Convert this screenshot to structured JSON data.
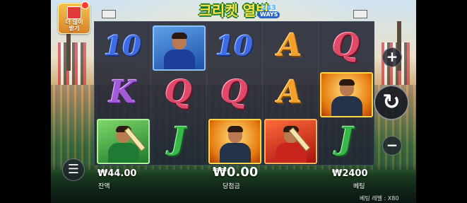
{
  "game": {
    "logo_title": "크리켓 열병",
    "logo_badge_number": "243",
    "logo_badge_text": "WAYS"
  },
  "promo_button": {
    "label_line1": "더 많이",
    "label_line2": "받기",
    "icon": "gift-icon"
  },
  "reels": [
    [
      {
        "type": "letter",
        "value": "10",
        "style": "g-10"
      },
      {
        "type": "letter",
        "value": "K",
        "style": "g-K"
      },
      {
        "type": "card",
        "icon": "batsman-green-icon",
        "color": "green"
      }
    ],
    [
      {
        "type": "card",
        "icon": "bowler-blue-icon",
        "color": "blue"
      },
      {
        "type": "letter",
        "value": "Q",
        "style": "g-Q"
      },
      {
        "type": "letter",
        "value": "J",
        "style": "g-J"
      }
    ],
    [
      {
        "type": "letter",
        "value": "10",
        "style": "g-10"
      },
      {
        "type": "letter",
        "value": "Q",
        "style": "g-Q"
      },
      {
        "type": "card",
        "icon": "captain-gold-icon",
        "color": "gold"
      }
    ],
    [
      {
        "type": "letter",
        "value": "A",
        "style": "g-A"
      },
      {
        "type": "letter",
        "value": "A",
        "style": "g-A"
      },
      {
        "type": "card",
        "icon": "batsman-red-icon",
        "color": "red"
      }
    ],
    [
      {
        "type": "letter",
        "value": "Q",
        "style": "g-Q"
      },
      {
        "type": "card",
        "icon": "captain-gold-icon",
        "color": "gold"
      },
      {
        "type": "letter",
        "value": "J",
        "style": "g-J"
      }
    ]
  ],
  "controls": {
    "plus_glyph": "+",
    "spin_glyph": "↻",
    "minus_glyph": "−",
    "menu_glyph": "☰"
  },
  "footer": {
    "balance_value": "₩44.00",
    "balance_label": "잔액",
    "win_value": "₩0.00",
    "win_label": "당첨금",
    "bet_value": "₩2400",
    "bet_label": "베팅",
    "bet_level_text": "베팅 레벨 : X80"
  }
}
